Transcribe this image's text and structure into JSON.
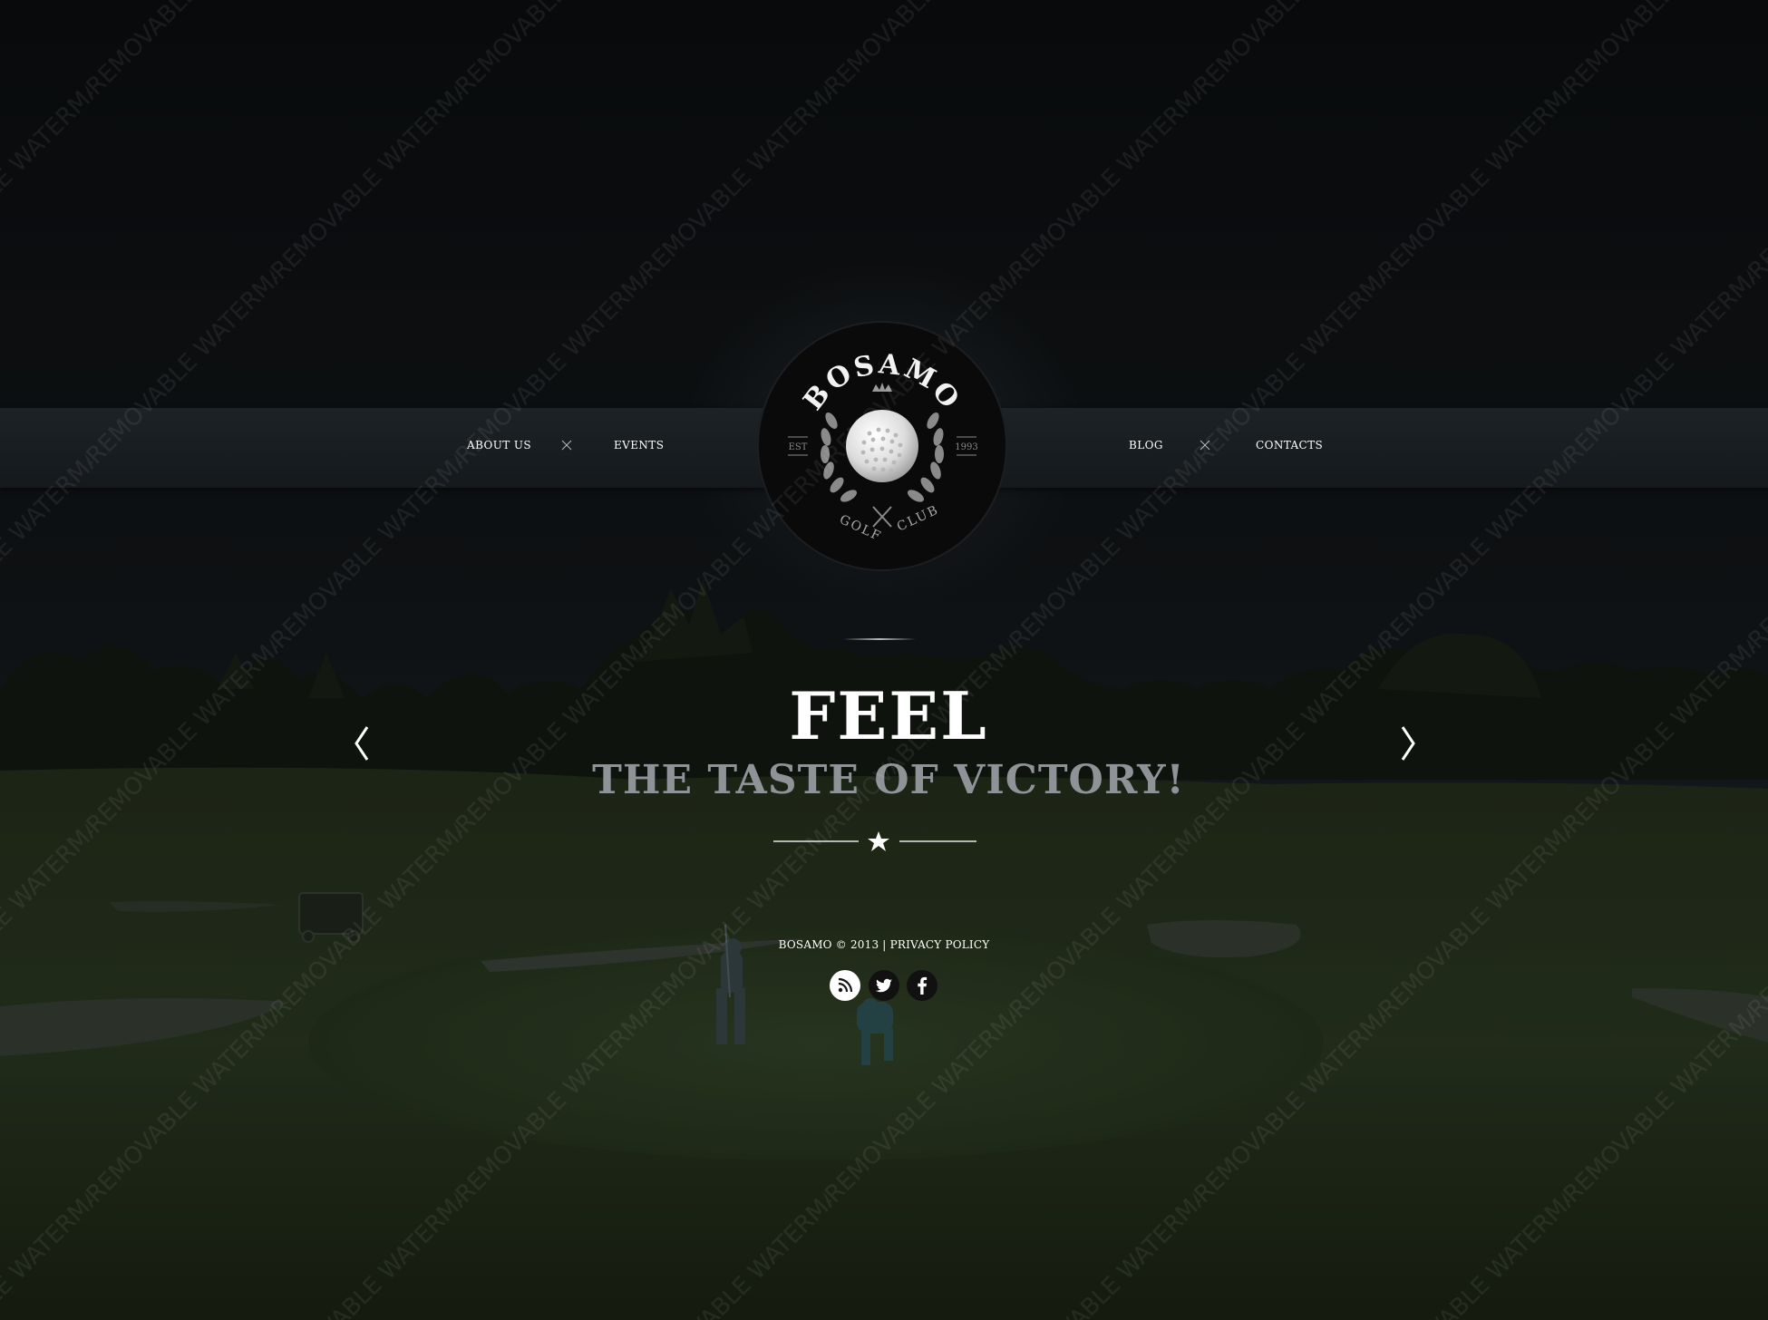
{
  "brand": {
    "name": "BOSAMO",
    "tagline_left": "GOLF",
    "tagline_right": "CLUB",
    "est_label": "EST",
    "est_year": "1993"
  },
  "nav": {
    "left": [
      {
        "label": "ABOUT US"
      },
      {
        "label": "EVENTS"
      }
    ],
    "right": [
      {
        "label": "BLOG"
      },
      {
        "label": "CONTACTS"
      }
    ]
  },
  "hero": {
    "title": "FEEL",
    "subtitle": "THE TASTE OF VICTORY!",
    "prev_icon": "chevron-left-icon",
    "next_icon": "chevron-right-icon"
  },
  "footer": {
    "copyright": "BOSAMO © 2013 |",
    "privacy_label": "PRIVACY POLICY",
    "social": [
      {
        "icon": "rss-icon"
      },
      {
        "icon": "twitter-icon"
      },
      {
        "icon": "facebook-icon"
      }
    ]
  },
  "watermark": {
    "text": "REMOVABLE WATERMARK"
  },
  "colors": {
    "background_top": "#0d0f11",
    "nav_bar": "#1a1e21",
    "grass": "#2d3a22",
    "subtitle": "#8f9296",
    "logo_fill": "#0a0a0a",
    "laurel": "#8a8a8a"
  }
}
